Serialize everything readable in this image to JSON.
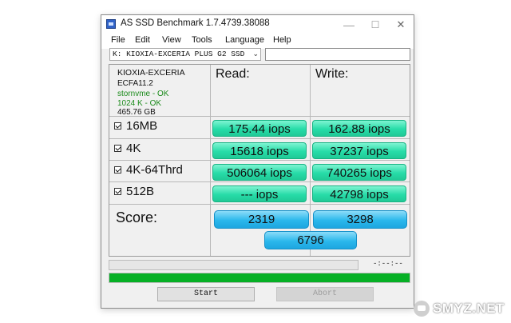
{
  "window": {
    "title": "AS SSD Benchmark 1.7.4739.38088",
    "controls": {
      "minimize": "—",
      "maximize": "☐",
      "close": "✕"
    }
  },
  "menu": [
    "File",
    "Edit",
    "View",
    "Tools",
    "Language",
    "Help"
  ],
  "drive_select": {
    "value": "K: KIOXIA-EXCERIA PLUS G2 SSD",
    "chevron": "⌄"
  },
  "drive_info": {
    "model": "KIOXIA-EXCERIA",
    "firmware": "ECFA11.2",
    "driver": "stornvme - OK",
    "alignment": "1024 K - OK",
    "size": "465.76 GB"
  },
  "columns": {
    "read": "Read:",
    "write": "Write:"
  },
  "tests": [
    {
      "label": "16MB",
      "read": "175.44 iops",
      "write": "162.88 iops"
    },
    {
      "label": "4K",
      "read": "15618 iops",
      "write": "37237 iops"
    },
    {
      "label": "4K-64Thrd",
      "read": "506064 iops",
      "write": "740265 iops"
    },
    {
      "label": "512B",
      "read": "--- iops",
      "write": "42798 iops"
    }
  ],
  "score": {
    "label": "Score:",
    "read": "2319",
    "write": "3298",
    "total": "6796"
  },
  "progress": {
    "time": "-:--:--",
    "completion": 1.0
  },
  "buttons": {
    "start": "Start",
    "abort": "Abort"
  },
  "colors": {
    "result_green": "#27dca8",
    "score_blue": "#2bb8ec",
    "progress_green": "#06b025"
  },
  "watermark": {
    "text": "SMYZ.NET"
  }
}
